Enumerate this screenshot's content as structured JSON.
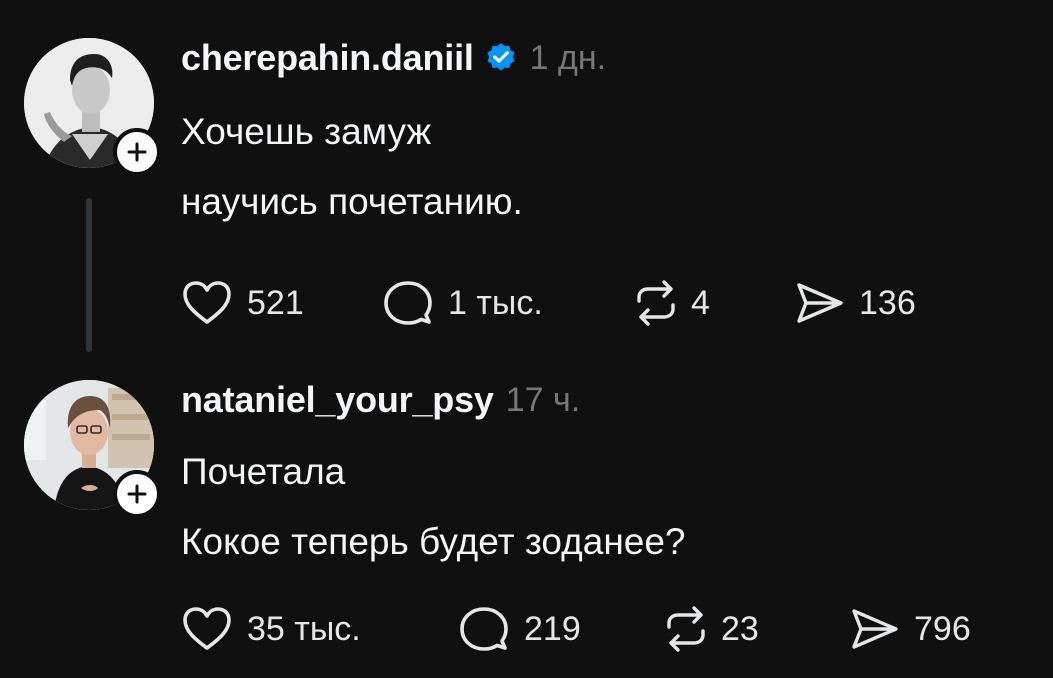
{
  "posts": [
    {
      "username": "cherepahin.daniil",
      "verified": true,
      "time": "1 дн.",
      "text_lines": [
        "Хочешь замуж",
        "научись почетанию."
      ],
      "actions": {
        "likes": "521",
        "comments": "1 тыс.",
        "reposts": "4",
        "shares": "136"
      }
    },
    {
      "username": "nataniel_your_psy",
      "verified": false,
      "time": "17 ч.",
      "text_lines": [
        "Почетала",
        "Кокое теперь будет зоданее?"
      ],
      "actions": {
        "likes": "35 тыс.",
        "comments": "219",
        "reposts": "23",
        "shares": "796"
      }
    }
  ],
  "icons": {
    "like": "heart-icon",
    "comment": "comment-bubble-icon",
    "repost": "repost-arrows-icon",
    "share": "send-arrow-icon",
    "follow": "plus-icon",
    "verified": "verified-badge-icon"
  },
  "colors": {
    "background": "#101010",
    "text": "#f3f5f7",
    "secondary": "#777777",
    "verified_badge": "#0095f6"
  }
}
